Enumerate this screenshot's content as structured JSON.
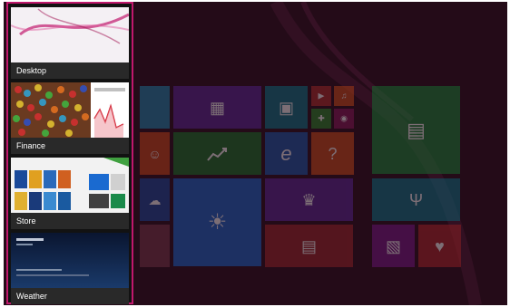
{
  "switcher": {
    "items": [
      {
        "label": "Desktop"
      },
      {
        "label": "Finance"
      },
      {
        "label": "Store"
      },
      {
        "label": "Weather"
      }
    ]
  },
  "start_tiles": [
    {
      "name": "tile-sport",
      "color": "#1e8bb0",
      "icon": "none"
    },
    {
      "name": "tile-calendar",
      "color": "#5a2a9a",
      "icon": "calendar-icon"
    },
    {
      "name": "tile-photos",
      "color": "#0a7a8a",
      "icon": "photo-icon"
    },
    {
      "name": "tile-video",
      "color": "#b0302a",
      "icon": "video-icon"
    },
    {
      "name": "tile-music",
      "color": "#d0501a",
      "icon": "headphones-icon"
    },
    {
      "name": "tile-games",
      "color": "#2a8a2a",
      "icon": "gamepad-icon"
    },
    {
      "name": "tile-camera",
      "color": "#8a1a5a",
      "icon": "camera-icon"
    },
    {
      "name": "tile-store",
      "color": "#1a8a3a",
      "icon": "store-icon"
    },
    {
      "name": "tile-people",
      "color": "#d04a1a",
      "icon": "people-icon"
    },
    {
      "name": "tile-finance",
      "color": "#1a7a2a",
      "icon": "chart-icon"
    },
    {
      "name": "tile-ie",
      "color": "#1a5ab0",
      "icon": "ie-icon"
    },
    {
      "name": "tile-help",
      "color": "#d0501a",
      "icon": "help-icon"
    },
    {
      "name": "tile-onedrive",
      "color": "#1a4aa0",
      "icon": "cloud-icon"
    },
    {
      "name": "tile-weather",
      "color": "#1a6ad0",
      "icon": "sun-icon"
    },
    {
      "name": "tile-sports",
      "color": "#5a2a9a",
      "icon": "trophy-icon"
    },
    {
      "name": "tile-food",
      "color": "#0a7a8a",
      "icon": "fork-knife-icon"
    },
    {
      "name": "tile-news",
      "color": "#a02a2a",
      "icon": "news-icon"
    },
    {
      "name": "tile-maps",
      "color": "#7a1a8a",
      "icon": "map-icon"
    },
    {
      "name": "tile-health",
      "color": "#b02a2a",
      "icon": "heart-icon"
    }
  ],
  "colors": {
    "accent": "#c0186c",
    "background": "#2a0f1d"
  }
}
